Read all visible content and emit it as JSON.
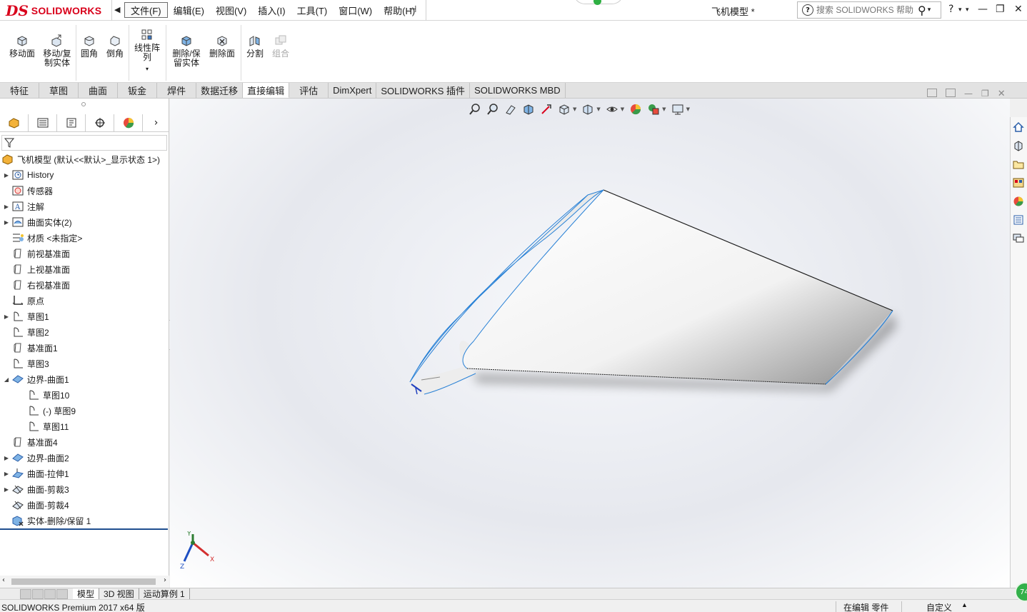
{
  "titlebar": {
    "logo_ds": "DS",
    "logo_text": "SOLIDWORKS",
    "menus": [
      "文件(F)",
      "编辑(E)",
      "视图(V)",
      "插入(I)",
      "工具(T)",
      "窗口(W)",
      "帮助(H)"
    ],
    "document_title": "飞机模型 *",
    "search_placeholder": "搜索 SOLIDWORKS 帮助",
    "help_label": "?"
  },
  "ribbon": {
    "commands": [
      {
        "label": "移动面",
        "icon": "move-face-icon"
      },
      {
        "label": "移动/复制实体",
        "icon": "move-copy-body-icon"
      },
      {
        "label": "圆角",
        "icon": "fillet-icon"
      },
      {
        "label": "倒角",
        "icon": "chamfer-icon"
      },
      {
        "label": "线性阵列",
        "icon": "linear-pattern-icon"
      },
      {
        "label": "删除/保留实体",
        "icon": "delete-keep-body-icon"
      },
      {
        "label": "删除面",
        "icon": "delete-face-icon"
      },
      {
        "label": "分割",
        "icon": "split-icon"
      },
      {
        "label": "组合",
        "icon": "combine-icon"
      }
    ]
  },
  "tabs": [
    "特征",
    "草图",
    "曲面",
    "钣金",
    "焊件",
    "数据迁移",
    "直接编辑",
    "评估",
    "DimXpert",
    "SOLIDWORKS 插件",
    "SOLIDWORKS MBD"
  ],
  "active_tab": "直接编辑",
  "tree": {
    "root": "飞机模型  (默认<<默认>_显示状态 1>)",
    "nodes": [
      {
        "label": "History",
        "icon": "history-icon",
        "expandable": true,
        "indent": 0
      },
      {
        "label": "传感器",
        "icon": "sensor-icon",
        "expandable": false,
        "indent": 0
      },
      {
        "label": "注解",
        "icon": "annotation-icon",
        "expandable": true,
        "indent": 0
      },
      {
        "label": "曲面实体(2)",
        "icon": "surface-bodies-icon",
        "expandable": true,
        "indent": 0
      },
      {
        "label": "材质 <未指定>",
        "icon": "material-icon",
        "expandable": false,
        "indent": 0
      },
      {
        "label": "前视基准面",
        "icon": "plane-icon",
        "expandable": false,
        "indent": 0
      },
      {
        "label": "上视基准面",
        "icon": "plane-icon",
        "expandable": false,
        "indent": 0
      },
      {
        "label": "右视基准面",
        "icon": "plane-icon",
        "expandable": false,
        "indent": 0
      },
      {
        "label": "原点",
        "icon": "origin-icon",
        "expandable": false,
        "indent": 0
      },
      {
        "label": "草图1",
        "icon": "sketch-icon",
        "expandable": true,
        "indent": 0
      },
      {
        "label": "草图2",
        "icon": "sketch-icon",
        "expandable": false,
        "indent": 0
      },
      {
        "label": "基准面1",
        "icon": "plane-icon",
        "expandable": false,
        "indent": 0
      },
      {
        "label": "草图3",
        "icon": "sketch-icon",
        "expandable": false,
        "indent": 0
      },
      {
        "label": "边界-曲面1",
        "icon": "boundary-surface-icon",
        "expandable": true,
        "expanded": true,
        "indent": 0
      },
      {
        "label": "草图10",
        "icon": "sketch-icon",
        "expandable": false,
        "indent": 1
      },
      {
        "label": "(-) 草图9",
        "icon": "sketch-icon",
        "expandable": false,
        "indent": 1
      },
      {
        "label": "草图11",
        "icon": "sketch-icon",
        "expandable": false,
        "indent": 1
      },
      {
        "label": "基准面4",
        "icon": "plane-icon",
        "expandable": false,
        "indent": 0
      },
      {
        "label": "边界-曲面2",
        "icon": "boundary-surface-icon",
        "expandable": true,
        "indent": 0
      },
      {
        "label": "曲面-拉伸1",
        "icon": "extrude-surface-icon",
        "expandable": true,
        "indent": 0
      },
      {
        "label": "曲面-剪裁3",
        "icon": "trim-surface-icon",
        "expandable": true,
        "indent": 0
      },
      {
        "label": "曲面-剪裁4",
        "icon": "trim-surface-icon",
        "expandable": false,
        "indent": 0
      },
      {
        "label": "实体-删除/保留 1",
        "icon": "delete-body-icon",
        "expandable": false,
        "indent": 0
      }
    ]
  },
  "bottom_tabs": [
    "模型",
    "3D 视图",
    "运动算例 1"
  ],
  "status": {
    "product": "SOLIDWORKS Premium 2017 x64 版",
    "editing": "在编辑 零件",
    "units": "自定义",
    "badge": "74"
  },
  "triad": {
    "x": "X",
    "y": "Y",
    "z": "Z"
  },
  "colors": {
    "brand": "#d9001b",
    "edge": "#2a82d6",
    "ok": "#33b04a"
  }
}
